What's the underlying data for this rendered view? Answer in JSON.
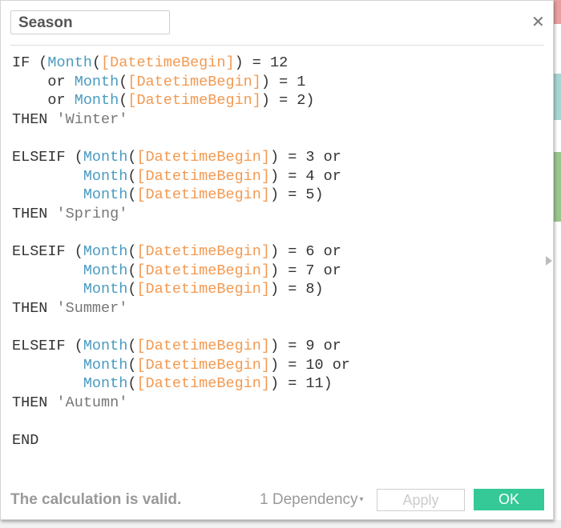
{
  "dialog": {
    "calc_name": "Season",
    "close_icon": "close-icon",
    "code_lines": [
      [
        [
          "kw",
          "IF ("
        ],
        [
          "fn",
          "Month"
        ],
        [
          "kw",
          "("
        ],
        [
          "fld",
          "[DatetimeBegin]"
        ],
        [
          "kw",
          ") = 12"
        ]
      ],
      [
        [
          "kw",
          "    or "
        ],
        [
          "fn",
          "Month"
        ],
        [
          "kw",
          "("
        ],
        [
          "fld",
          "[DatetimeBegin]"
        ],
        [
          "kw",
          ") = 1"
        ]
      ],
      [
        [
          "kw",
          "    or "
        ],
        [
          "fn",
          "Month"
        ],
        [
          "kw",
          "("
        ],
        [
          "fld",
          "[DatetimeBegin]"
        ],
        [
          "kw",
          ") = 2)"
        ]
      ],
      [
        [
          "kw",
          "THEN "
        ],
        [
          "str",
          "'Winter'"
        ]
      ],
      [],
      [
        [
          "kw",
          "ELSEIF ("
        ],
        [
          "fn",
          "Month"
        ],
        [
          "kw",
          "("
        ],
        [
          "fld",
          "[DatetimeBegin]"
        ],
        [
          "kw",
          ") = 3 or"
        ]
      ],
      [
        [
          "kw",
          "        "
        ],
        [
          "fn",
          "Month"
        ],
        [
          "kw",
          "("
        ],
        [
          "fld",
          "[DatetimeBegin]"
        ],
        [
          "kw",
          ") = 4 or"
        ]
      ],
      [
        [
          "kw",
          "        "
        ],
        [
          "fn",
          "Month"
        ],
        [
          "kw",
          "("
        ],
        [
          "fld",
          "[DatetimeBegin]"
        ],
        [
          "kw",
          ") = 5)"
        ]
      ],
      [
        [
          "kw",
          "THEN "
        ],
        [
          "str",
          "'Spring'"
        ]
      ],
      [],
      [
        [
          "kw",
          "ELSEIF ("
        ],
        [
          "fn",
          "Month"
        ],
        [
          "kw",
          "("
        ],
        [
          "fld",
          "[DatetimeBegin]"
        ],
        [
          "kw",
          ") = 6 or"
        ]
      ],
      [
        [
          "kw",
          "        "
        ],
        [
          "fn",
          "Month"
        ],
        [
          "kw",
          "("
        ],
        [
          "fld",
          "[DatetimeBegin]"
        ],
        [
          "kw",
          ") = 7 or"
        ]
      ],
      [
        [
          "kw",
          "        "
        ],
        [
          "fn",
          "Month"
        ],
        [
          "kw",
          "("
        ],
        [
          "fld",
          "[DatetimeBegin]"
        ],
        [
          "kw",
          ") = 8)"
        ]
      ],
      [
        [
          "kw",
          "THEN "
        ],
        [
          "str",
          "'Summer'"
        ]
      ],
      [],
      [
        [
          "kw",
          "ELSEIF ("
        ],
        [
          "fn",
          "Month"
        ],
        [
          "kw",
          "("
        ],
        [
          "fld",
          "[DatetimeBegin]"
        ],
        [
          "kw",
          ") = 9 or"
        ]
      ],
      [
        [
          "kw",
          "        "
        ],
        [
          "fn",
          "Month"
        ],
        [
          "kw",
          "("
        ],
        [
          "fld",
          "[DatetimeBegin]"
        ],
        [
          "kw",
          ") = 10 or"
        ]
      ],
      [
        [
          "kw",
          "        "
        ],
        [
          "fn",
          "Month"
        ],
        [
          "kw",
          "("
        ],
        [
          "fld",
          "[DatetimeBegin]"
        ],
        [
          "kw",
          ") = 11)"
        ]
      ],
      [
        [
          "kw",
          "THEN "
        ],
        [
          "str",
          "'Autumn'"
        ]
      ],
      [],
      [
        [
          "kw",
          "END"
        ]
      ]
    ],
    "status": "The calculation is valid.",
    "dependency_label": "1 Dependency",
    "dependency_caret": "▾",
    "apply_label": "Apply",
    "ok_label": "OK",
    "colors": {
      "function": "#4a9bc0",
      "field": "#f39a52",
      "string": "#777777",
      "ok_button": "#34c997"
    }
  },
  "background": {
    "strips": [
      "#e8a0a0",
      "#a9d5d2",
      "#9bc78f"
    ]
  }
}
